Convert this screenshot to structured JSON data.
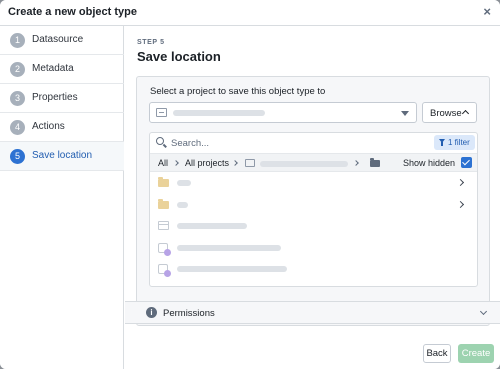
{
  "dialog": {
    "title": "Create a new object type",
    "close_glyph": "×"
  },
  "steps": [
    {
      "number": "1",
      "label": "Datasource",
      "active": false
    },
    {
      "number": "2",
      "label": "Metadata",
      "active": false
    },
    {
      "number": "3",
      "label": "Properties",
      "active": false
    },
    {
      "number": "4",
      "label": "Actions",
      "active": false
    },
    {
      "number": "5",
      "label": "Save location",
      "active": true
    }
  ],
  "main": {
    "step_caption": "STEP 5",
    "step_title": "Save location",
    "select_label": "Select a project to save this object type to",
    "browse_label": "Browse",
    "search": {
      "placeholder": "Search..."
    },
    "filter_label": "1 filter",
    "breadcrumb": {
      "all": "All",
      "all_projects": "All projects"
    },
    "show_hidden_label": "Show hidden",
    "show_hidden_checked": true,
    "rows": [
      {
        "type": "folder",
        "has_children": true
      },
      {
        "type": "folder",
        "has_children": true
      },
      {
        "type": "document",
        "has_children": false
      },
      {
        "type": "object",
        "has_children": false
      },
      {
        "type": "object",
        "has_children": false
      }
    ]
  },
  "permissions": {
    "label": "Permissions",
    "info_glyph": "i"
  },
  "footer": {
    "back_label": "Back",
    "create_label": "Create",
    "create_enabled": false
  },
  "colors": {
    "accent": "#2d72d2",
    "create_disabled": "#9dd3b0",
    "folder": "#ead29a"
  }
}
